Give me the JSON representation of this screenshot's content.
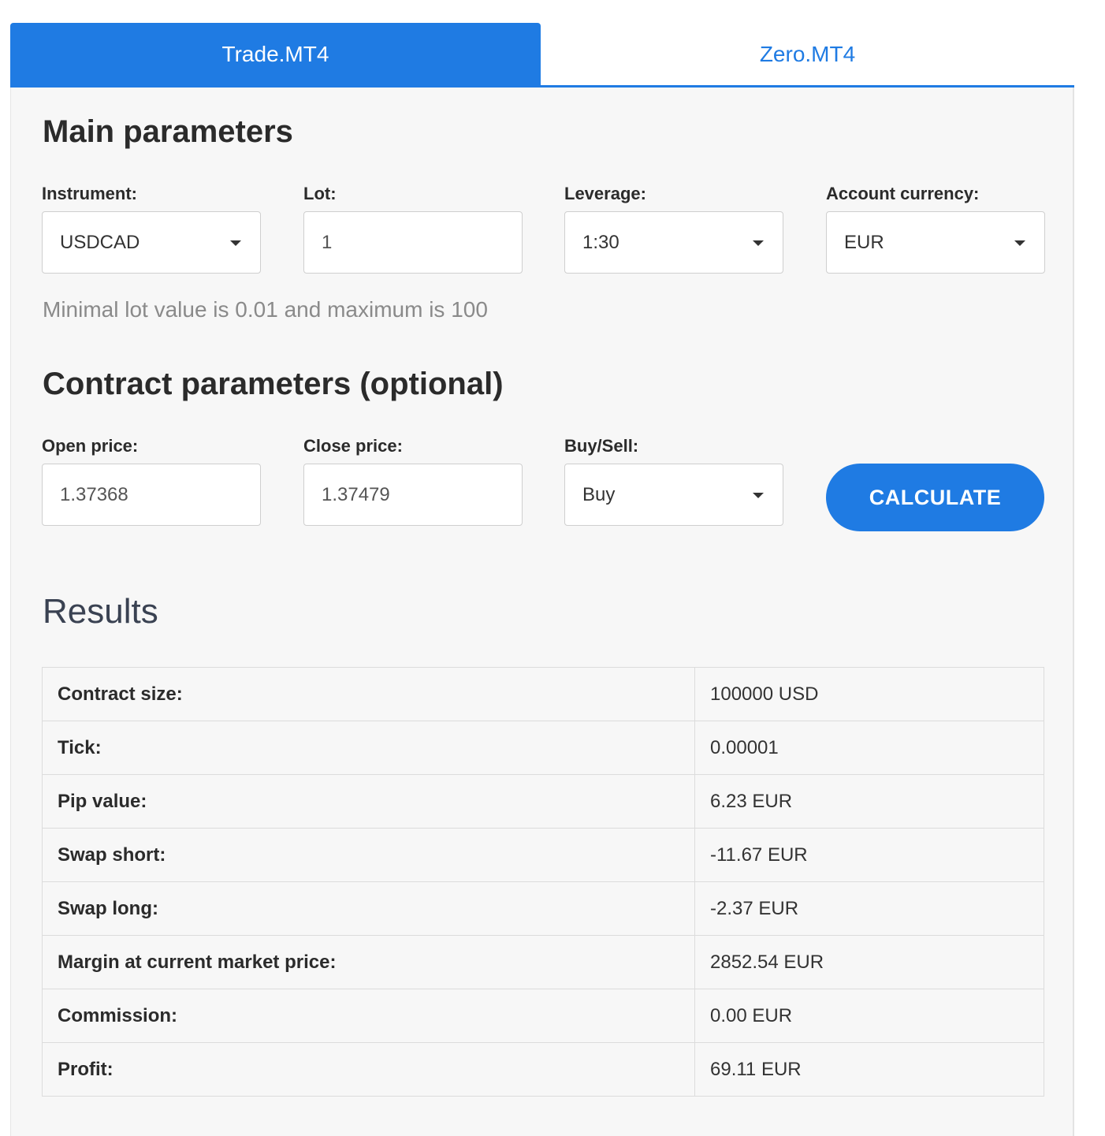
{
  "tabs": [
    {
      "label": "Trade.MT4",
      "active": true
    },
    {
      "label": "Zero.MT4",
      "active": false
    }
  ],
  "main": {
    "title": "Main parameters",
    "instrument": {
      "label": "Instrument:",
      "value": "USDCAD"
    },
    "lot": {
      "label": "Lot:",
      "value": "1"
    },
    "leverage": {
      "label": "Leverage:",
      "value": "1:30"
    },
    "account_currency": {
      "label": "Account currency:",
      "value": "EUR"
    },
    "hint": "Minimal lot value is 0.01 and maximum is 100"
  },
  "contract": {
    "title": "Contract parameters (optional)",
    "open_price": {
      "label": "Open price:",
      "value": "1.37368"
    },
    "close_price": {
      "label": "Close price:",
      "value": "1.37479"
    },
    "buy_sell": {
      "label": "Buy/Sell:",
      "value": "Buy"
    },
    "calculate_label": "CALCULATE"
  },
  "results": {
    "title": "Results",
    "rows": [
      {
        "label": "Contract size:",
        "value": "100000 USD"
      },
      {
        "label": "Tick:",
        "value": "0.00001"
      },
      {
        "label": "Pip value:",
        "value": "6.23 EUR"
      },
      {
        "label": "Swap short:",
        "value": "-11.67 EUR"
      },
      {
        "label": "Swap long:",
        "value": "-2.37 EUR"
      },
      {
        "label": "Margin at current market price:",
        "value": "2852.54 EUR"
      },
      {
        "label": "Commission:",
        "value": "0.00 EUR"
      },
      {
        "label": "Profit:",
        "value": "69.11 EUR"
      }
    ]
  },
  "colors": {
    "accent": "#1f7be3",
    "panel_bg": "#f7f7f7"
  }
}
